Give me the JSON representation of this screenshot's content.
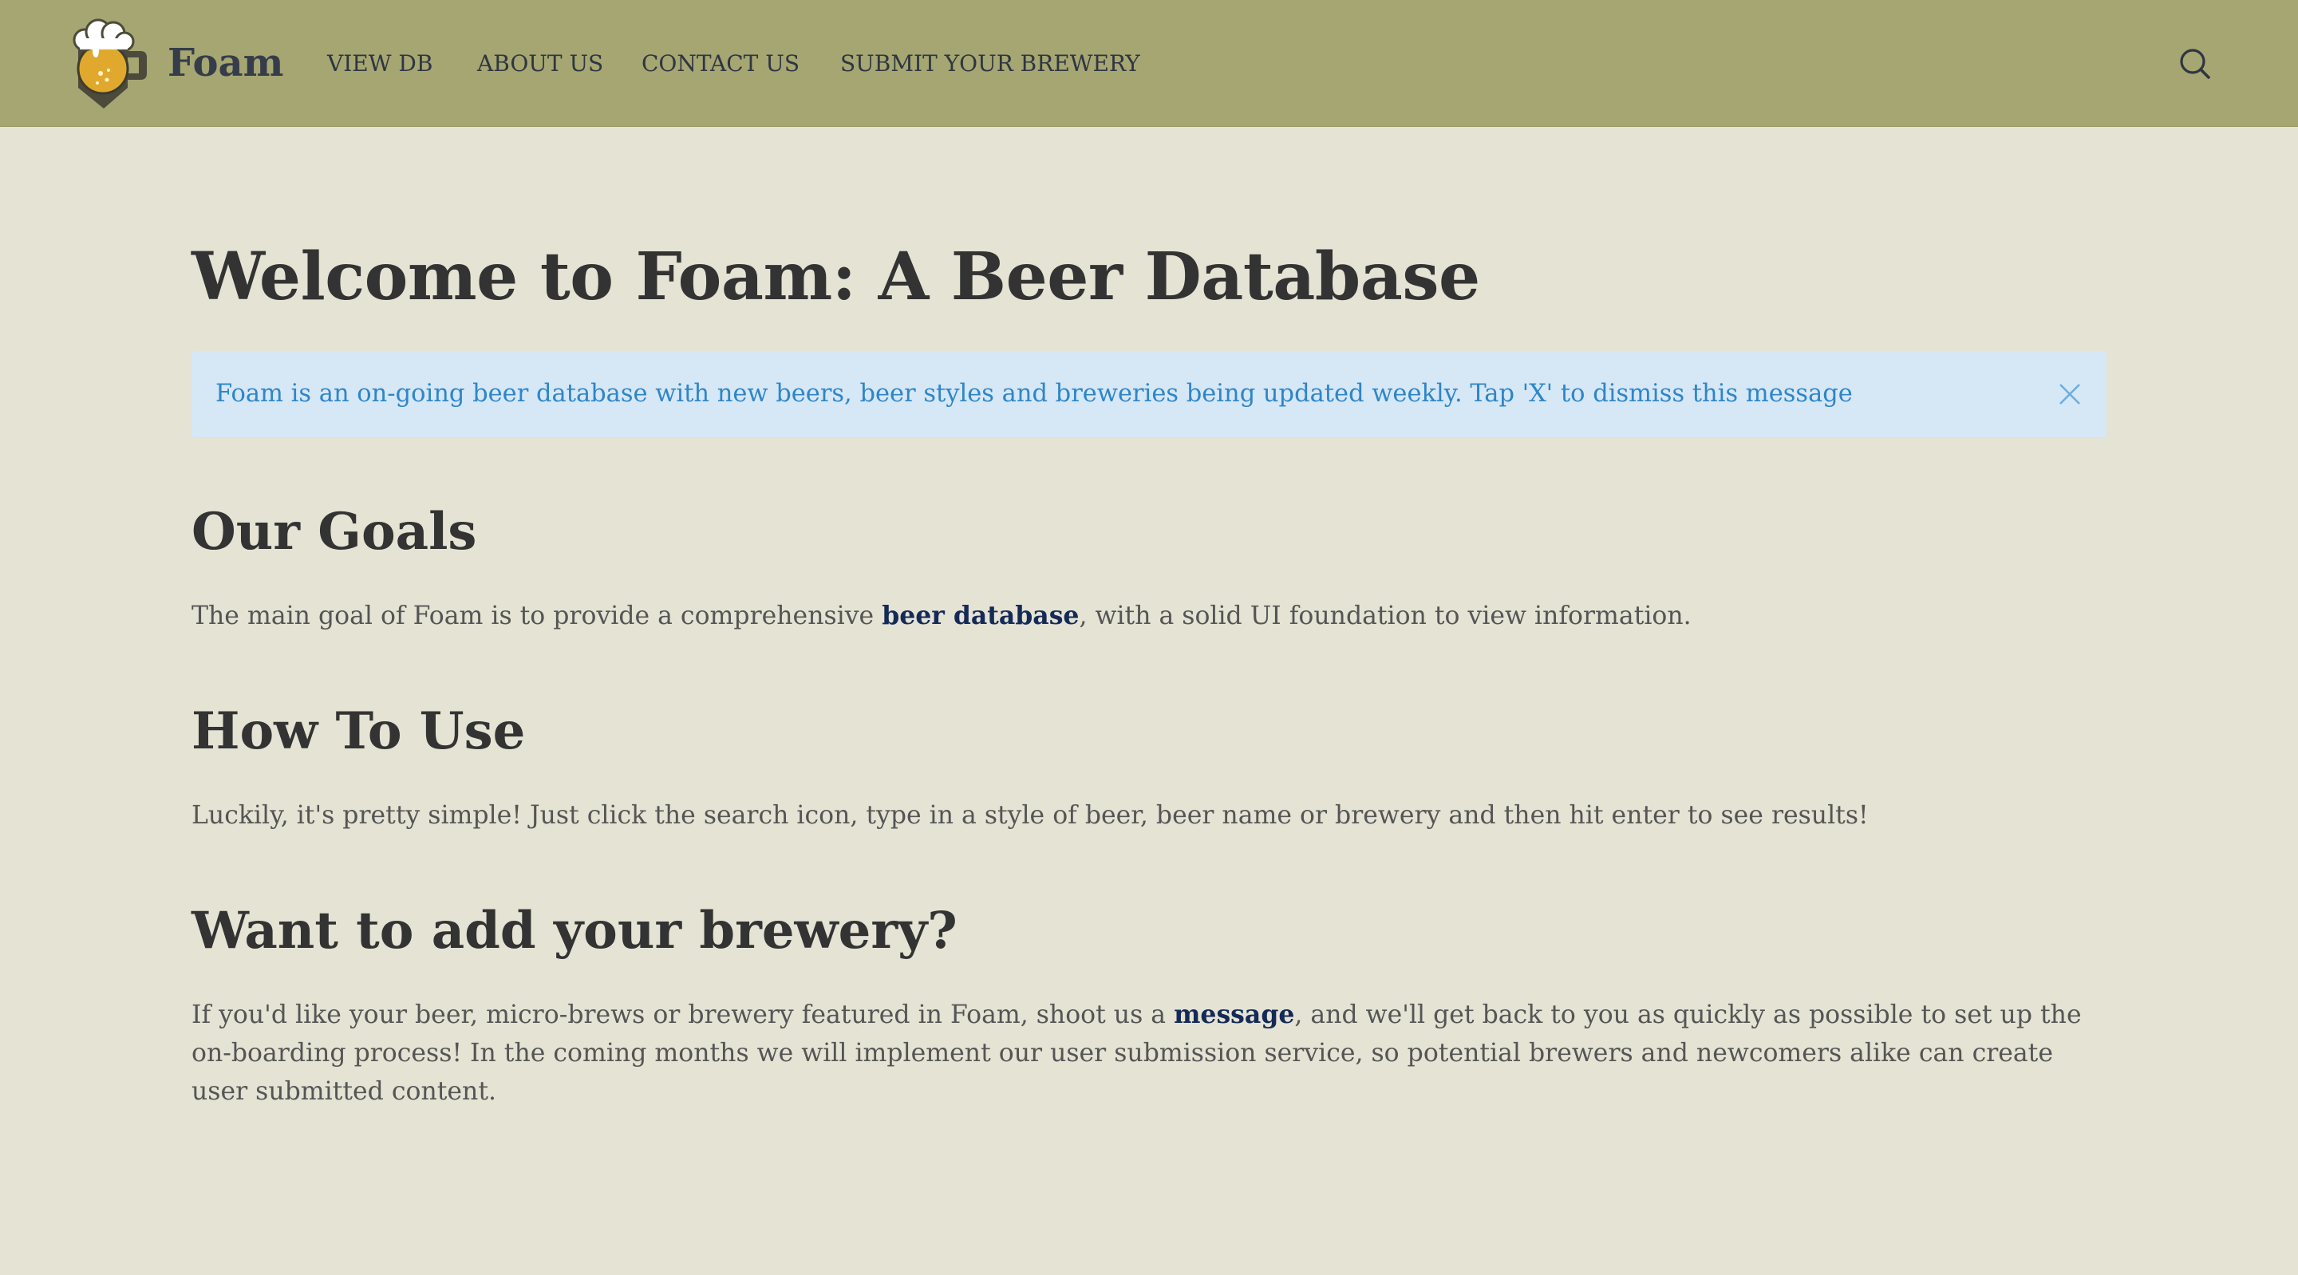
{
  "brand": {
    "name": "Foam"
  },
  "nav": {
    "items": [
      {
        "label": "VIEW DB"
      },
      {
        "label": "ABOUT US"
      },
      {
        "label": "CONTACT US"
      },
      {
        "label": "SUBMIT YOUR BREWERY"
      }
    ],
    "search_icon": "search-icon"
  },
  "page": {
    "title": "Welcome to Foam: A Beer Database"
  },
  "notice": {
    "text": "Foam is an on-going beer database with new beers, beer styles and breweries being updated weekly. Tap 'X' to dismiss this message",
    "close_icon": "close-icon"
  },
  "sections": {
    "goals": {
      "heading": "Our Goals",
      "text_before": "The main goal of Foam is to provide a comprehensive ",
      "link": "beer database",
      "text_after": ", with a solid UI foundation to view information."
    },
    "how_to_use": {
      "heading": "How To Use",
      "text": "Luckily, it's pretty simple! Just click the search icon, type in a style of beer, beer name or brewery and then hit enter to see results!"
    },
    "add_brewery": {
      "heading": "Want to add your brewery?",
      "text_before": "If you'd like your beer, micro-brews or brewery featured in Foam, shoot us a ",
      "link": "message",
      "text_after": ", and we'll get back to you as quickly as possible to set up the on-boarding process! In the coming months we will implement our user submission service, so potential brewers and newcomers alike can create user submitted content."
    }
  },
  "colors": {
    "navbar": "#a5a671",
    "background": "#e4e3d4",
    "notice_bg": "#d6e7f6",
    "notice_text": "#2e86c8",
    "link": "#142a57"
  }
}
